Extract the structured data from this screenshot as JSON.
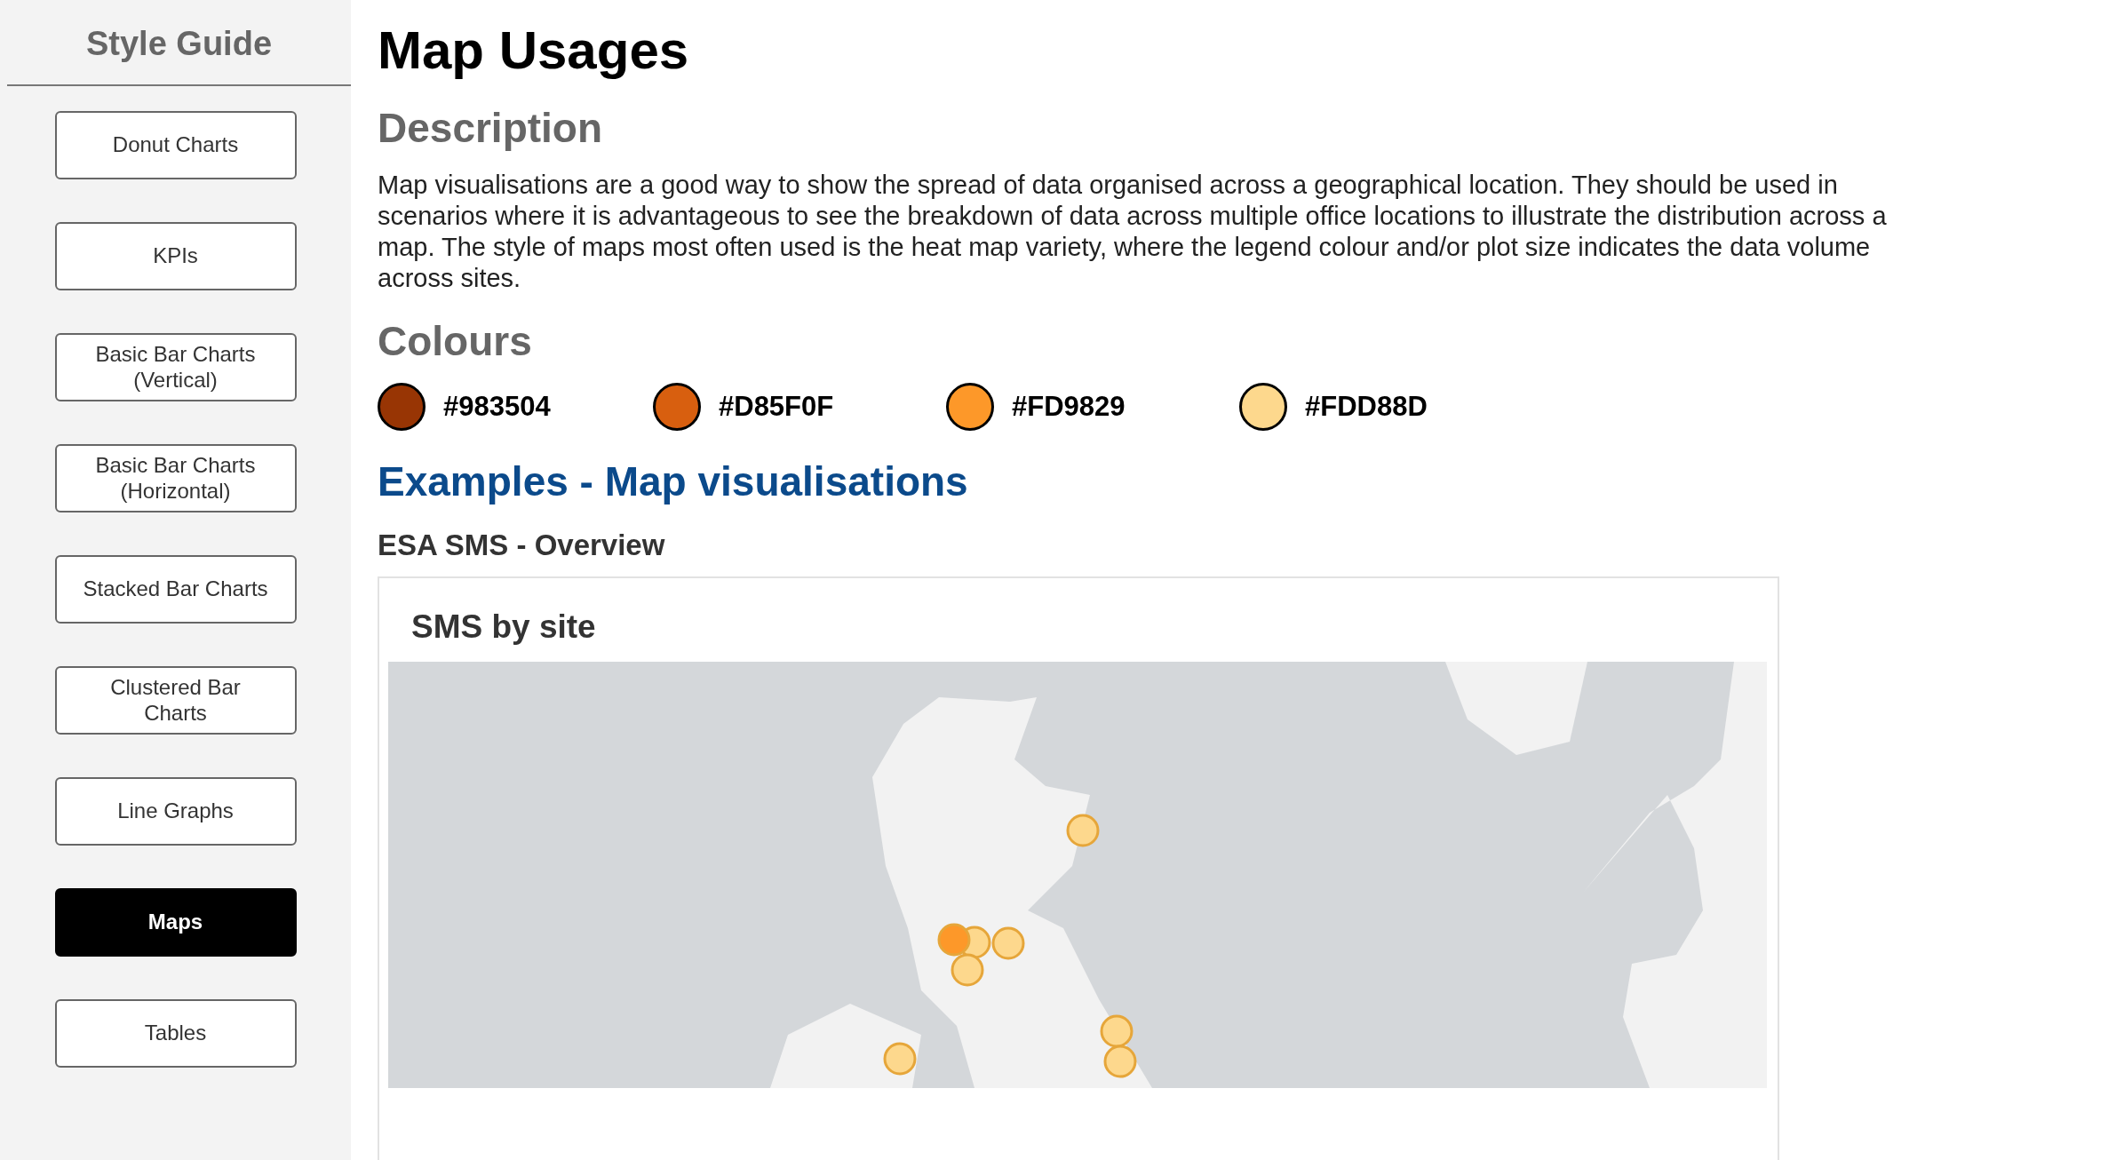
{
  "sidebar": {
    "title": "Style Guide",
    "items": [
      {
        "label": "Donut Charts",
        "selected": false
      },
      {
        "label": "KPIs",
        "selected": false
      },
      {
        "label": "Basic Bar Charts (Vertical)",
        "selected": false
      },
      {
        "label": "Basic Bar Charts (Horizontal)",
        "selected": false
      },
      {
        "label": "Stacked Bar Charts",
        "selected": false
      },
      {
        "label": "Clustered Bar Charts",
        "selected": false
      },
      {
        "label": "Line Graphs",
        "selected": false
      },
      {
        "label": "Maps",
        "selected": true
      },
      {
        "label": "Tables",
        "selected": false
      }
    ]
  },
  "page": {
    "title": "Map Usages",
    "description_heading": "Description",
    "description": "Map visualisations are a good way to show the spread of data organised across a geographical location. They should be used in scenarios where it is advantageous to see the breakdown of data across multiple office locations to illustrate the distribution across a map.  The style of maps most often used is the heat map variety, where the legend colour and/or plot size indicates the data volume across sites.",
    "colours_heading": "Colours",
    "colours": [
      {
        "label": "#983504",
        "color": "#983504"
      },
      {
        "label": "#D85F0F",
        "color": "#d85f0f"
      },
      {
        "label": "#FD9829",
        "color": "#fd9829"
      },
      {
        "label": "#FDD88D",
        "color": "#fdd88d"
      }
    ],
    "examples_heading": "Examples - Map visualisations",
    "example_title": "ESA SMS - Overview",
    "card": {
      "title": "SMS by site",
      "markers": [
        {
          "color": "#fdd88d"
        },
        {
          "color": "#fdd88d"
        },
        {
          "color": "#fdd88d"
        },
        {
          "color": "#fdd88d"
        },
        {
          "color": "#fd9829"
        },
        {
          "color": "#fdd88d"
        },
        {
          "color": "#fdd88d"
        },
        {
          "color": "#fdd88d"
        }
      ]
    }
  }
}
